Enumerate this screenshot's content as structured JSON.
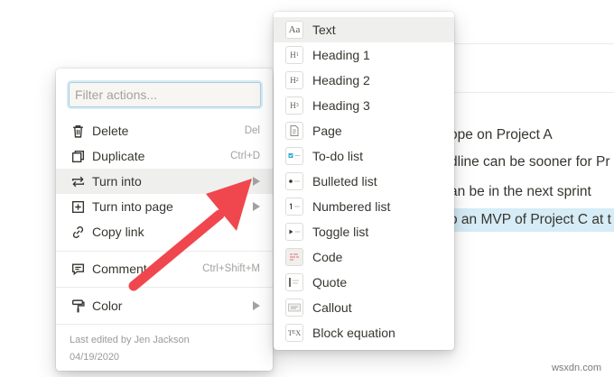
{
  "background": {
    "lines": [
      "ope on Project A",
      "dline can be sooner for Pr",
      "an be in the next sprint",
      "o an MVP of Project C at t"
    ]
  },
  "menu": {
    "filter_placeholder": "Filter actions...",
    "items": [
      {
        "label": "Delete",
        "shortcut": "Del",
        "icon": "trash-icon"
      },
      {
        "label": "Duplicate",
        "shortcut": "Ctrl+D",
        "icon": "duplicate-icon"
      },
      {
        "label": "Turn into",
        "shortcut": "",
        "icon": "turn-into-icon"
      },
      {
        "label": "Turn into page",
        "shortcut": "",
        "icon": "add-page-icon"
      },
      {
        "label": "Copy link",
        "shortcut": "",
        "icon": "link-icon"
      },
      {
        "label": "Comment",
        "shortcut": "Ctrl+Shift+M",
        "icon": "comment-icon"
      },
      {
        "label": "Color",
        "shortcut": "",
        "icon": "paint-roller-icon"
      }
    ],
    "footer": {
      "last_edited": "Last edited by Jen Jackson",
      "date": "04/19/2020"
    }
  },
  "submenu": {
    "items": [
      {
        "label": "Text",
        "icon": "text-block-icon"
      },
      {
        "label": "Heading 1",
        "icon": "heading1-icon"
      },
      {
        "label": "Heading 2",
        "icon": "heading2-icon"
      },
      {
        "label": "Heading 3",
        "icon": "heading3-icon"
      },
      {
        "label": "Page",
        "icon": "page-icon"
      },
      {
        "label": "To-do list",
        "icon": "todo-icon"
      },
      {
        "label": "Bulleted list",
        "icon": "bulleted-list-icon"
      },
      {
        "label": "Numbered list",
        "icon": "numbered-list-icon"
      },
      {
        "label": "Toggle list",
        "icon": "toggle-list-icon"
      },
      {
        "label": "Code",
        "icon": "code-icon"
      },
      {
        "label": "Quote",
        "icon": "quote-icon"
      },
      {
        "label": "Callout",
        "icon": "callout-icon"
      },
      {
        "label": "Block equation",
        "icon": "equation-icon"
      }
    ]
  },
  "watermark": "wsxdn.com",
  "colors": {
    "hover": "#efefee",
    "highlight": "#d6ecf6",
    "arrow": "#f0474e",
    "focus_ring": "#a8cfe3"
  }
}
